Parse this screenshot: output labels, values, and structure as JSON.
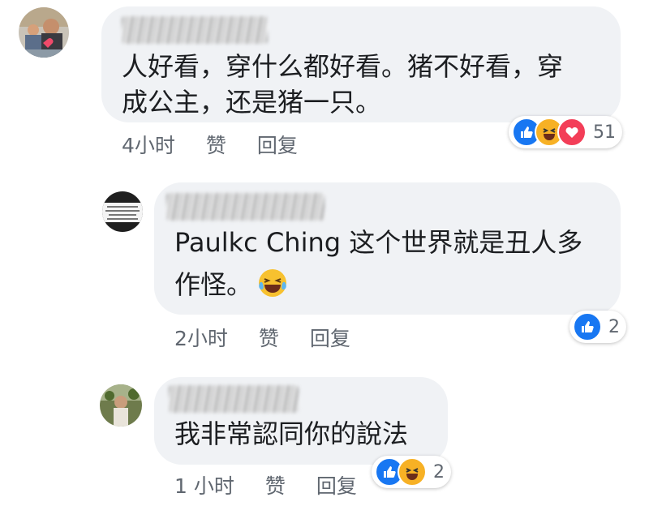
{
  "comments": [
    {
      "text_lines": [
        "人好看，穿什么都好看。猪不好看，穿",
        "成公主，还是猪一只。"
      ],
      "time": "4小时",
      "like_label": "赞",
      "reply_label": "回复",
      "reaction_count": "51",
      "reaction_icons": [
        "like-icon",
        "haha-icon",
        "love-icon"
      ]
    },
    {
      "text_lines": [
        "Paulkc Ching 这个世界就是丑人多",
        "作怪。"
      ],
      "inline_emoji": "tears-of-joy-emoji",
      "time": "2小时",
      "like_label": "赞",
      "reply_label": "回复",
      "reaction_count": "2",
      "reaction_icons": [
        "like-icon"
      ]
    },
    {
      "text_lines": [
        "我非常認同你的說法"
      ],
      "time": "1 小时",
      "like_label": "赞",
      "reply_label": "回复",
      "reaction_count": "2",
      "reaction_icons": [
        "like-icon",
        "haha-icon"
      ]
    }
  ]
}
